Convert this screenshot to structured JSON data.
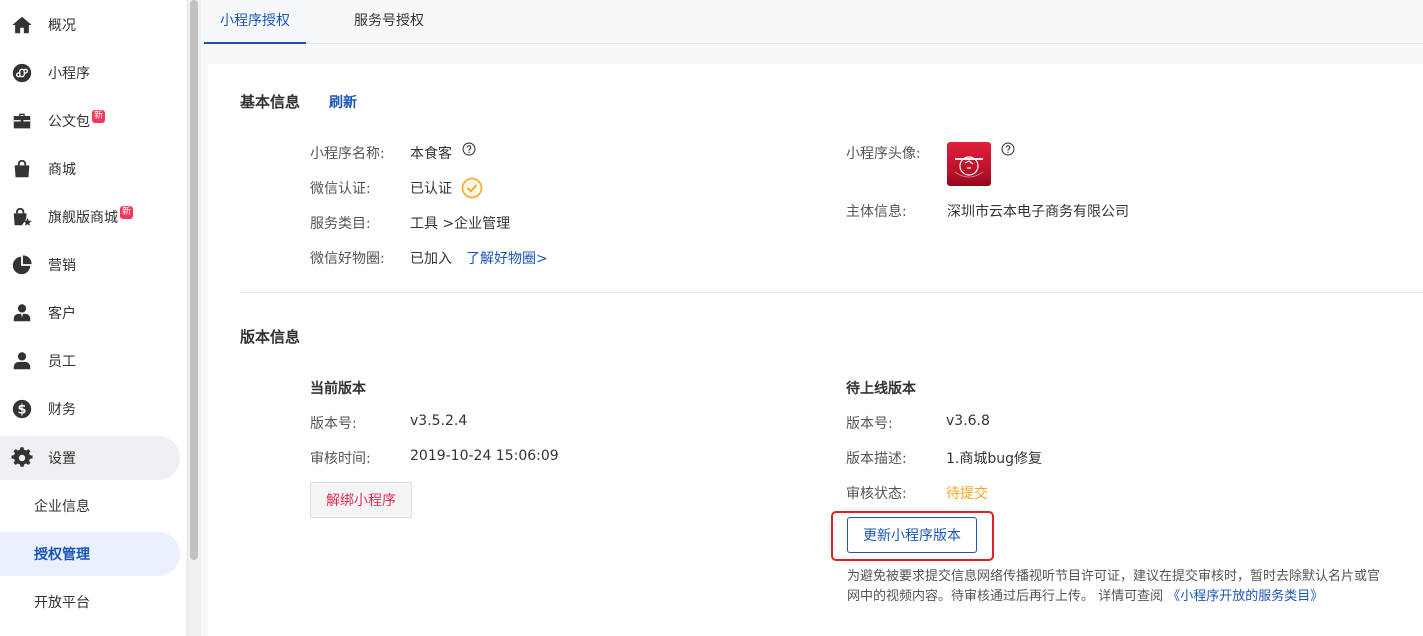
{
  "sidebar": {
    "items": [
      {
        "label": "概况",
        "icon": "home-icon"
      },
      {
        "label": "小程序",
        "icon": "mini-program-icon"
      },
      {
        "label": "公文包",
        "icon": "briefcase-icon",
        "badge": "新"
      },
      {
        "label": "商城",
        "icon": "shopping-bag-icon"
      },
      {
        "label": "旗舰版商城",
        "icon": "shopping-bag-star-icon",
        "badge": "新"
      },
      {
        "label": "营销",
        "icon": "pie-chart-icon"
      },
      {
        "label": "客户",
        "icon": "customer-icon"
      },
      {
        "label": "员工",
        "icon": "user-icon"
      },
      {
        "label": "财务",
        "icon": "dollar-icon"
      },
      {
        "label": "设置",
        "icon": "gear-icon"
      }
    ],
    "sub_items": [
      {
        "label": "企业信息"
      },
      {
        "label": "授权管理"
      },
      {
        "label": "开放平台"
      }
    ]
  },
  "tabs": [
    {
      "label": "小程序授权"
    },
    {
      "label": "服务号授权"
    }
  ],
  "basic": {
    "title": "基本信息",
    "refresh": "刷新",
    "name_label": "小程序名称:",
    "name_value": "本食客",
    "wechat_cert_label": "微信认证:",
    "wechat_cert_value": "已认证",
    "category_label": "服务类目:",
    "category_value": "工具 >企业管理",
    "goods_label": "微信好物圈:",
    "goods_value": "已加入",
    "goods_link": "了解好物圈>",
    "avatar_label": "小程序头像:",
    "subject_label": "主体信息:",
    "subject_value": "深圳市云本电子商务有限公司"
  },
  "version": {
    "title": "版本信息",
    "current_title": "当前版本",
    "current_version_label": "版本号:",
    "current_version_value": "v3.5.2.4",
    "audit_time_label": "审核时间:",
    "audit_time_value": "2019-10-24 15:06:09",
    "unbind_button": "解绑小程序",
    "pending_title": "待上线版本",
    "pending_version_label": "版本号:",
    "pending_version_value": "v3.6.8",
    "desc_label": "版本描述:",
    "desc_value": "1.商城bug修复",
    "status_label": "审核状态:",
    "status_value": "待提交",
    "update_button": "更新小程序版本",
    "notice_text": "为避免被要求提交信息网络传播视听节目许可证，建议在提交审核时，暂时去除默认名片或官网中的视频内容。待审核通过后再行上传。 详情可查阅 ",
    "notice_link": "《小程序开放的服务类目》"
  },
  "colors": {
    "accent": "#1a56b6",
    "danger": "#e02d56",
    "pending": "#f5a623",
    "highlight": "#e02020"
  }
}
